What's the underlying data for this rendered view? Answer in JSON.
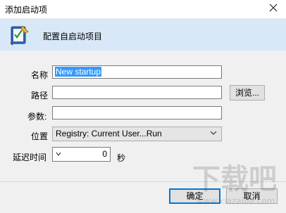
{
  "window": {
    "title": "添加启动项",
    "close_icon": "close-icon"
  },
  "header": {
    "title": "配置自启动项目",
    "icon": "startup-tool-icon"
  },
  "form": {
    "name_label": "名称",
    "name_value": "New startup",
    "path_label": "路径",
    "path_value": "",
    "browse_label": "浏览...",
    "params_label": "参数:",
    "params_value": "",
    "location_label": "位置",
    "location_value": "Registry: Current User...Run",
    "delay_label": "延迟时间",
    "delay_value": "0",
    "delay_unit": "秒"
  },
  "footer": {
    "ok_label": "确定",
    "cancel_label": "取消"
  },
  "watermark": {
    "text": "下载吧",
    "domain": "www.xiazaiba.com"
  },
  "colors": {
    "header_bg": "#d9e8f8",
    "selection": "#3399ff",
    "dialog_bg": "#f0f0f0"
  }
}
